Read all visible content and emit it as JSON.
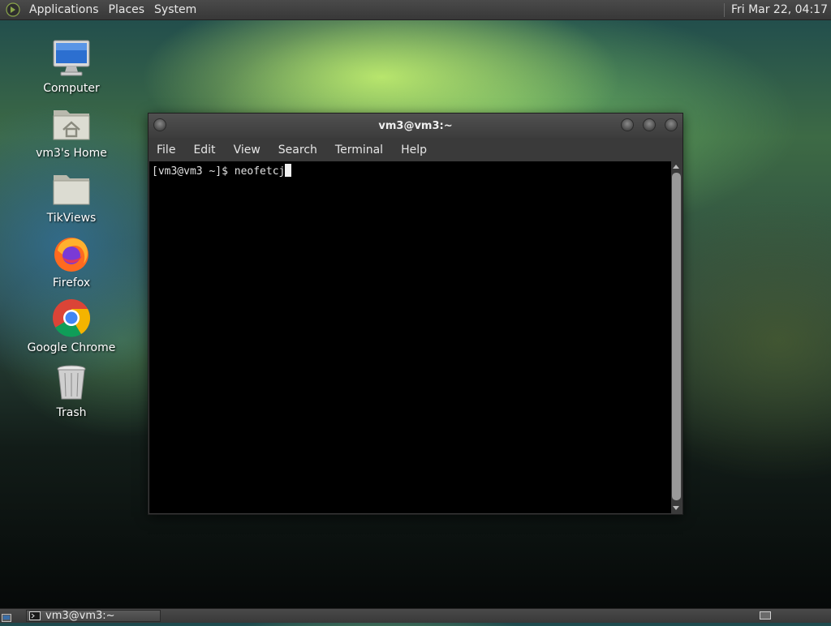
{
  "top_panel": {
    "menus": [
      "Applications",
      "Places",
      "System"
    ],
    "clock": "Fri Mar 22, 04:17"
  },
  "desktop_icons": [
    {
      "label": "Computer",
      "icon": "computer-icon"
    },
    {
      "label": "vm3's Home",
      "icon": "home-folder-icon"
    },
    {
      "label": "TikViews",
      "icon": "folder-icon"
    },
    {
      "label": "Firefox",
      "icon": "firefox-icon"
    },
    {
      "label": "Google Chrome",
      "icon": "chrome-icon"
    },
    {
      "label": "Trash",
      "icon": "trash-icon"
    }
  ],
  "terminal": {
    "title": "vm3@vm3:~",
    "menus": [
      "File",
      "Edit",
      "View",
      "Search",
      "Terminal",
      "Help"
    ],
    "prompt": "[vm3@vm3 ~]$ ",
    "command": "neofetcj"
  },
  "taskbar": {
    "window_label": "vm3@vm3:~"
  },
  "colors": {
    "panel": "#3c3c3c",
    "terminal_bg": "#000000",
    "terminal_fg": "#e0e0e0"
  }
}
